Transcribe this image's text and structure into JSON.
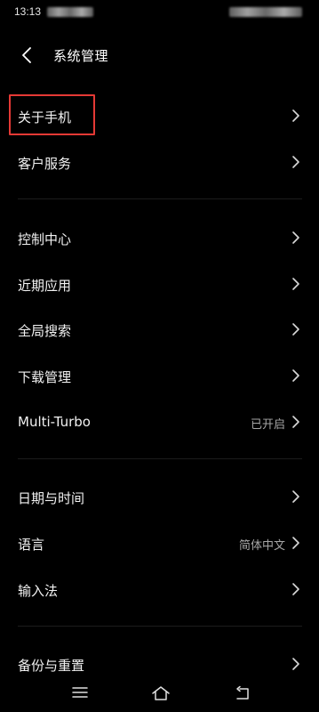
{
  "status_bar": {
    "time": "13:13"
  },
  "header": {
    "title": "系统管理",
    "back_icon": "chevron-left-icon"
  },
  "sections": [
    {
      "items": [
        {
          "label": "关于手机",
          "value": null,
          "icon": "chevron-right-icon"
        },
        {
          "label": "客户服务",
          "value": null,
          "icon": "chevron-right-icon"
        }
      ]
    },
    {
      "items": [
        {
          "label": "控制中心",
          "value": null,
          "icon": "chevron-right-icon"
        },
        {
          "label": "近期应用",
          "value": null,
          "icon": "chevron-right-icon"
        },
        {
          "label": "全局搜索",
          "value": null,
          "icon": "chevron-right-icon"
        },
        {
          "label": "下载管理",
          "value": null,
          "icon": "chevron-right-icon"
        },
        {
          "label": "Multi-Turbo",
          "value": "已开启",
          "icon": "chevron-right-icon"
        }
      ]
    },
    {
      "items": [
        {
          "label": "日期与时间",
          "value": null,
          "icon": "chevron-right-icon"
        },
        {
          "label": "语言",
          "value": "简体中文",
          "icon": "chevron-right-icon"
        },
        {
          "label": "输入法",
          "value": null,
          "icon": "chevron-right-icon"
        }
      ]
    },
    {
      "items": [
        {
          "label": "备份与重置",
          "value": null,
          "icon": "chevron-right-icon"
        }
      ]
    }
  ],
  "nav_bar": {
    "menu_icon": "menu-icon",
    "home_icon": "home-icon",
    "back_icon": "back-icon"
  },
  "colors": {
    "background": "#000000",
    "text": "#f2f2f2",
    "secondary_text": "#a6a6a6",
    "highlight_border": "#e53935"
  }
}
